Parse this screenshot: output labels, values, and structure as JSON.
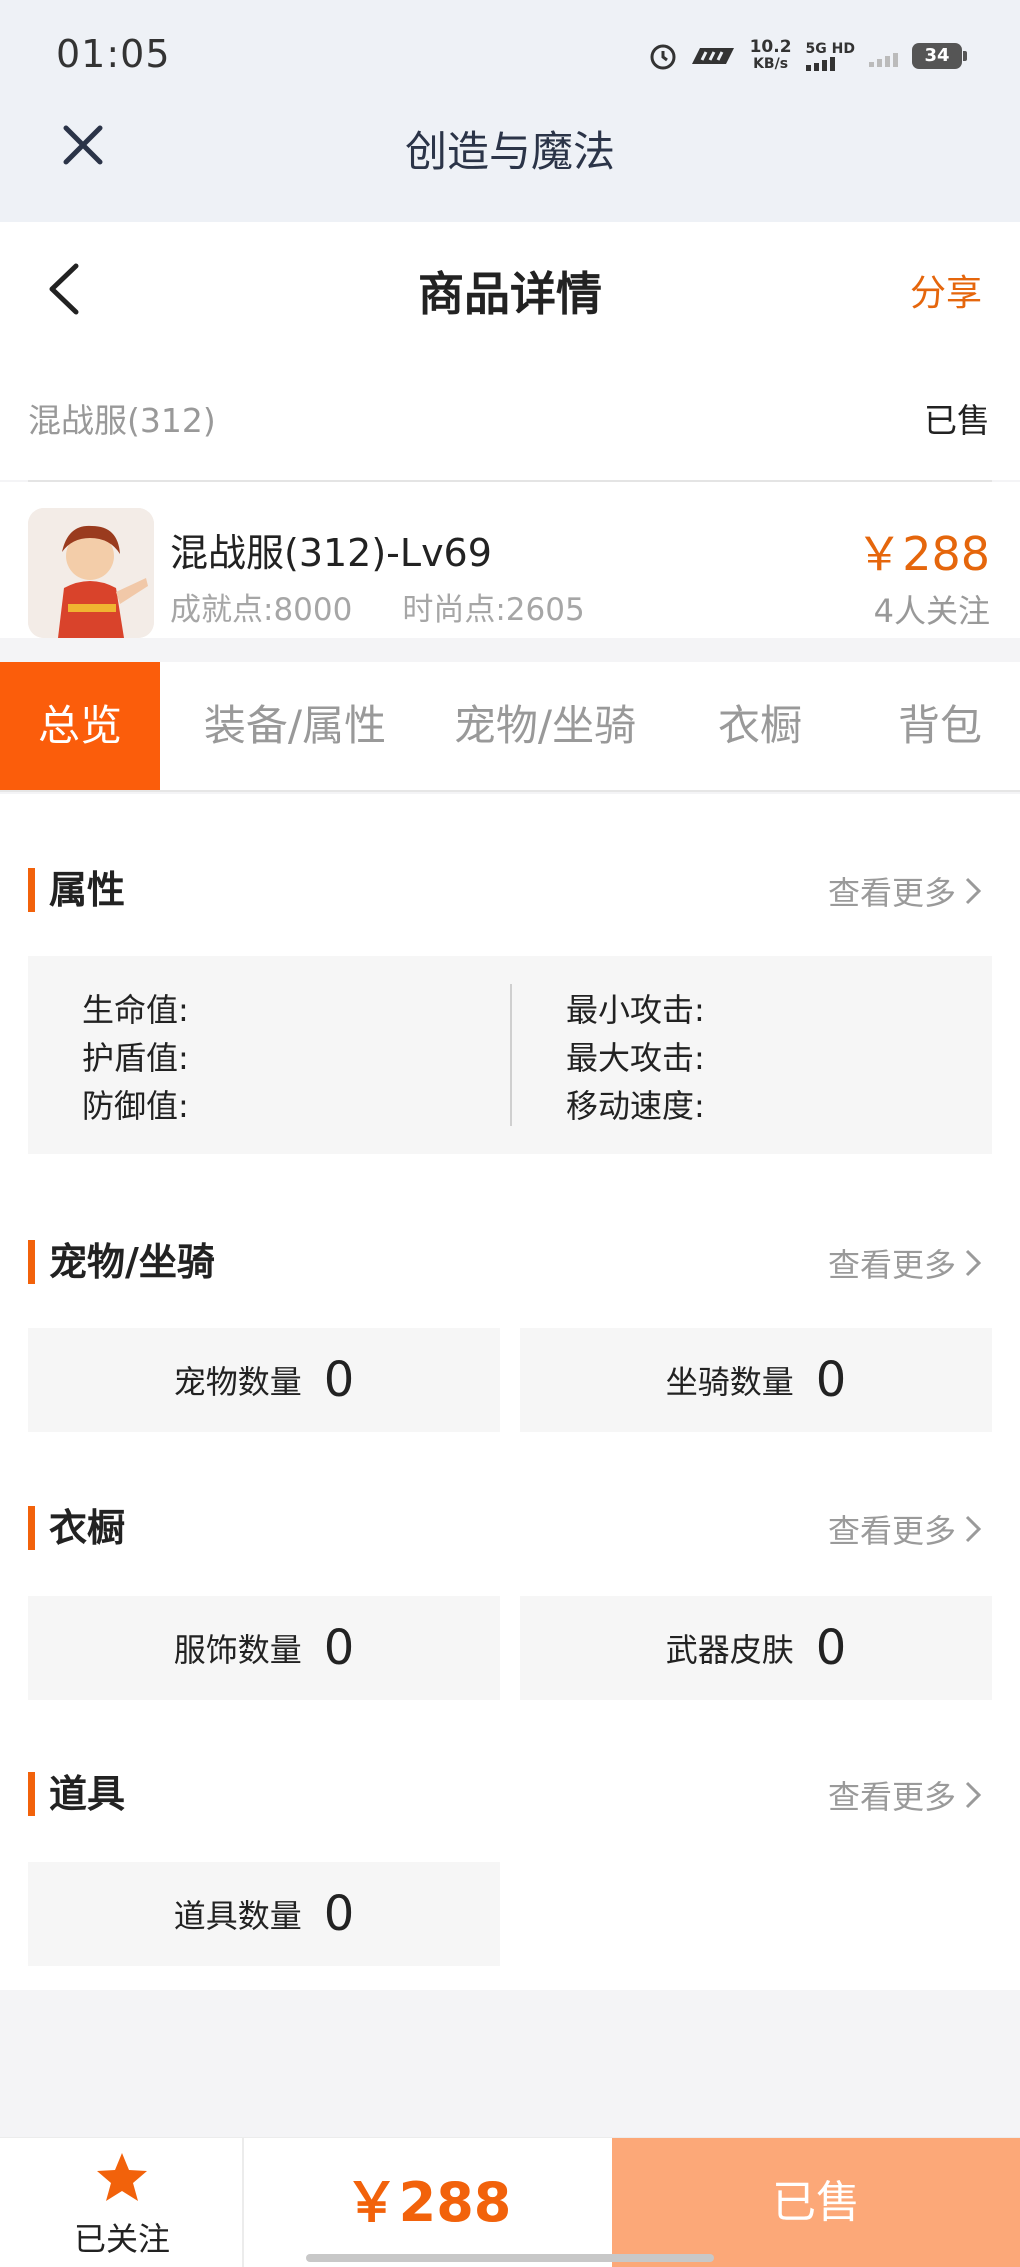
{
  "status_bar": {
    "time": "01:05",
    "speed_value": "10.2",
    "speed_unit": "KB/s",
    "network": "5G HD",
    "battery": "34"
  },
  "app": {
    "title": "创造与魔法"
  },
  "header": {
    "title": "商品详情",
    "share_label": "分享"
  },
  "server_row": {
    "name": "混战服(312)",
    "status": "已售"
  },
  "product": {
    "title": "混战服(312)-Lv69",
    "achievement": "成就点:8000",
    "fashion": "时尚点:2605",
    "price": "￥288",
    "followers": "4人关注"
  },
  "tabs": [
    "总览",
    "装备/属性",
    "宠物/坐骑",
    "衣橱",
    "背包"
  ],
  "sections": {
    "attributes": {
      "title": "属性",
      "more": "查看更多",
      "left": [
        "生命值:",
        "护盾值:",
        "防御值:"
      ],
      "right": [
        "最小攻击:",
        "最大攻击:",
        "移动速度:"
      ]
    },
    "pets": {
      "title": "宠物/坐骑",
      "more": "查看更多",
      "items": [
        {
          "label": "宠物数量",
          "value": "0"
        },
        {
          "label": "坐骑数量",
          "value": "0"
        }
      ]
    },
    "wardrobe": {
      "title": "衣橱",
      "more": "查看更多",
      "items": [
        {
          "label": "服饰数量",
          "value": "0"
        },
        {
          "label": "武器皮肤",
          "value": "0"
        }
      ]
    },
    "items": {
      "title": "道具",
      "more": "查看更多",
      "items": [
        {
          "label": "道具数量",
          "value": "0"
        }
      ]
    }
  },
  "bottom_bar": {
    "follow_label": "已关注",
    "price": "￥288",
    "sold_label": "已售"
  },
  "colors": {
    "accent": "#f2620b",
    "tab_active": "#fb5d0b",
    "sold_button": "#fca878"
  }
}
